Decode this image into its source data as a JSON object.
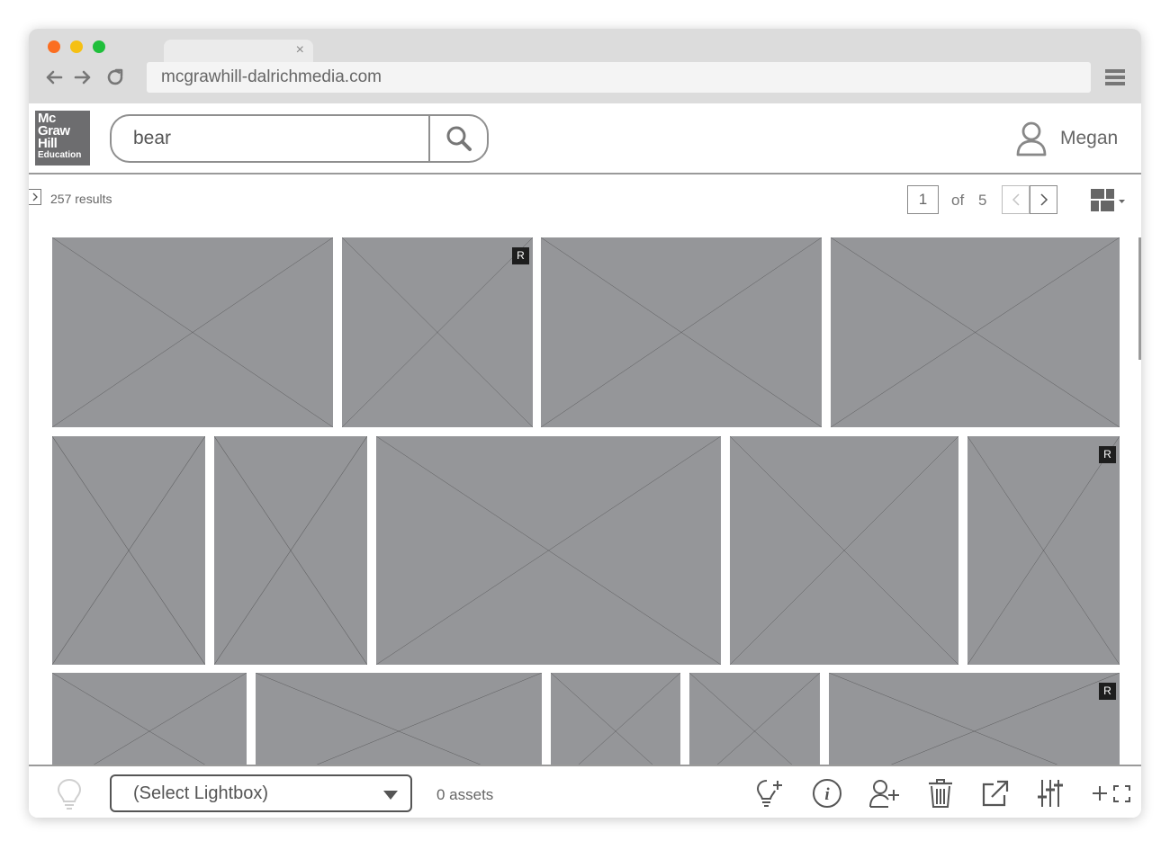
{
  "browser": {
    "traffic_lights": [
      "#fb6e21",
      "#f5c013",
      "#1fbf3b"
    ],
    "tab_close": "×",
    "url": "mcgrawhill-dalrichmedia.com",
    "nav_icons": [
      "back-arrow-icon",
      "forward-arrow-icon",
      "reload-icon",
      "hamburger-menu-icon"
    ]
  },
  "header": {
    "logo_lines": [
      "Mc",
      "Graw",
      "Hill",
      "Education"
    ],
    "search_value": "bear",
    "search_icon": "magnifier-icon",
    "user_name": "Megan",
    "user_icon": "user-icon"
  },
  "results_bar": {
    "results_text": "257 results",
    "current_page": "1",
    "of_label": "of",
    "total_pages": "5",
    "view_icon": "masonry-grid-view-icon"
  },
  "grid": {
    "image_placeholder_color": "#959699",
    "badge_label": "R",
    "images": [
      {
        "badge": false
      },
      {
        "badge": true
      },
      {
        "badge": false
      },
      {
        "badge": false
      },
      {
        "badge": false
      },
      {
        "badge": false
      },
      {
        "badge": false
      },
      {
        "badge": false
      },
      {
        "badge": true
      },
      {
        "badge": false
      },
      {
        "badge": false
      },
      {
        "badge": false
      },
      {
        "badge": false
      },
      {
        "badge": true
      }
    ]
  },
  "footer": {
    "lightbox_select": "(Select Lightbox)",
    "asset_count": "0 assets",
    "action_icons": [
      "add-idea-icon",
      "info-icon",
      "add-user-icon",
      "trash-icon",
      "external-link-icon",
      "sliders-icon",
      "add-fullscreen-icon"
    ]
  }
}
